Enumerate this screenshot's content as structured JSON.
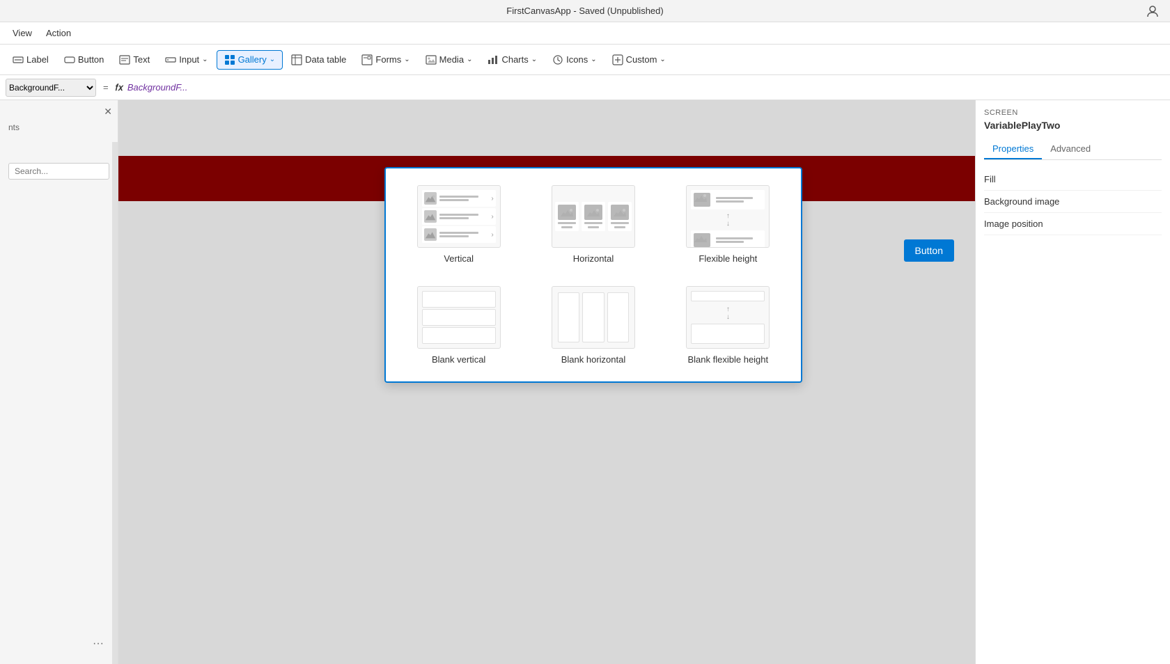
{
  "app": {
    "title": "FirstCanvasApp - Saved (Unpublished)"
  },
  "topbar": {
    "view_label": "View",
    "action_label": "Action"
  },
  "toolbar": {
    "label_btn": "Label",
    "button_btn": "Button",
    "text_btn": "Text",
    "input_btn": "Input",
    "gallery_btn": "Gallery",
    "datatable_btn": "Data table",
    "forms_btn": "Forms",
    "media_btn": "Media",
    "charts_btn": "Charts",
    "icons_btn": "Icons",
    "custom_btn": "Custom"
  },
  "formula_bar": {
    "property": "BackgroundF...",
    "fx": "fx",
    "eq": "="
  },
  "right_panel": {
    "screen_label": "SCREEN",
    "screen_name": "VariablePlayTwo",
    "tab_properties": "Properties",
    "tab_advanced": "Advanced",
    "prop_fill": "Fill",
    "prop_background_image": "Background image",
    "prop_image_position": "Image position"
  },
  "gallery_dropdown": {
    "items": [
      {
        "id": "vertical",
        "label": "Vertical",
        "type": "content"
      },
      {
        "id": "horizontal",
        "label": "Horizontal",
        "type": "content"
      },
      {
        "id": "flexible-height",
        "label": "Flexible height",
        "type": "content"
      },
      {
        "id": "blank-vertical",
        "label": "Blank vertical",
        "type": "blank"
      },
      {
        "id": "blank-horizontal",
        "label": "Blank horizontal",
        "type": "blank"
      },
      {
        "id": "blank-flexible-height",
        "label": "Blank flexible height",
        "type": "blank"
      }
    ]
  },
  "canvas": {
    "button_label": "Button"
  },
  "left_panel": {
    "more_icon": "···"
  },
  "icons": {
    "close": "✕",
    "chevron_down": "⌄",
    "chevron_up": "^",
    "expand": "↕"
  }
}
